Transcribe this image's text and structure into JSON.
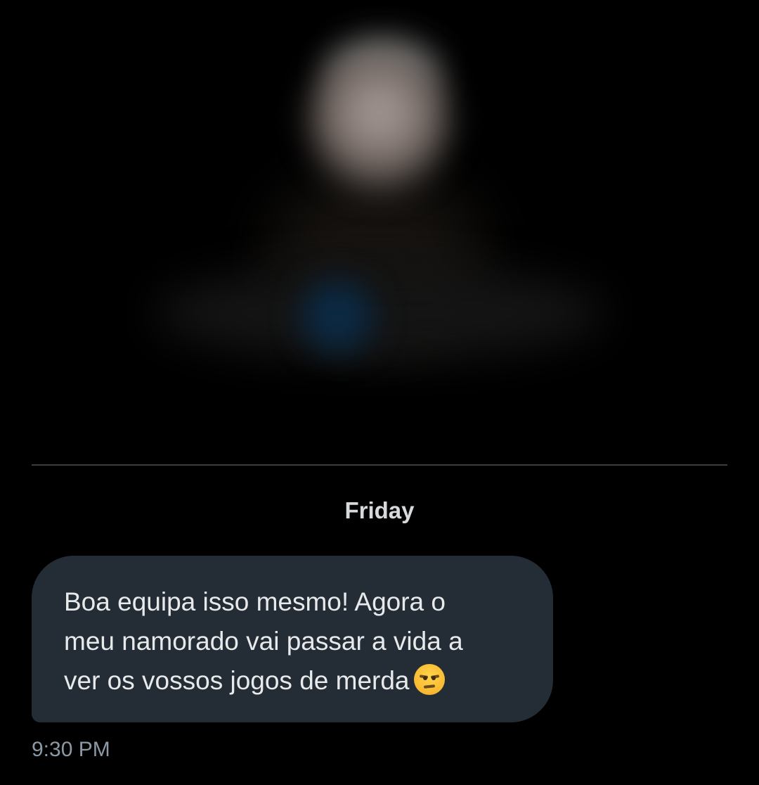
{
  "conversation": {
    "date_separator": "Friday",
    "messages": [
      {
        "text": "Boa equipa isso mesmo! Agora o\nmeu namorado vai passar a vida a\nver os vossos jogos de merda",
        "emoji": "unamused-face-icon",
        "timestamp": "9:30 PM"
      }
    ]
  },
  "colors": {
    "background": "#000000",
    "bubble": "#242d35",
    "message_text": "#e7e9ea",
    "timestamp_text": "#8b98a5",
    "divider": "#3a3d41"
  }
}
